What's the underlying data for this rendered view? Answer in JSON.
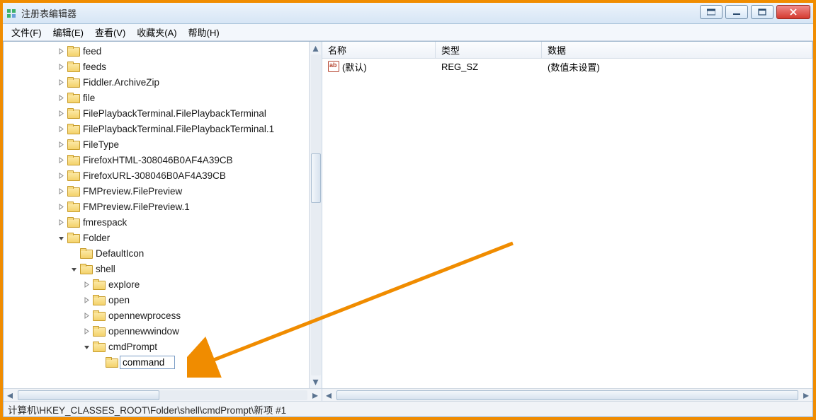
{
  "window": {
    "title": "注册表编辑器"
  },
  "menu": {
    "file": "文件(F)",
    "edit": "编辑(E)",
    "view": "查看(V)",
    "favorites": "收藏夹(A)",
    "help": "帮助(H)"
  },
  "tree": {
    "items": [
      {
        "label": "feed",
        "depth": 3,
        "expandable": true
      },
      {
        "label": "feeds",
        "depth": 3,
        "expandable": true
      },
      {
        "label": "Fiddler.ArchiveZip",
        "depth": 3,
        "expandable": true
      },
      {
        "label": "file",
        "depth": 3,
        "expandable": true
      },
      {
        "label": "FilePlaybackTerminal.FilePlaybackTerminal",
        "depth": 3,
        "expandable": true
      },
      {
        "label": "FilePlaybackTerminal.FilePlaybackTerminal.1",
        "depth": 3,
        "expandable": true
      },
      {
        "label": "FileType",
        "depth": 3,
        "expandable": true
      },
      {
        "label": "FirefoxHTML-308046B0AF4A39CB",
        "depth": 3,
        "expandable": true
      },
      {
        "label": "FirefoxURL-308046B0AF4A39CB",
        "depth": 3,
        "expandable": true
      },
      {
        "label": "FMPreview.FilePreview",
        "depth": 3,
        "expandable": true
      },
      {
        "label": "FMPreview.FilePreview.1",
        "depth": 3,
        "expandable": true
      },
      {
        "label": "fmrespack",
        "depth": 3,
        "expandable": true
      },
      {
        "label": "Folder",
        "depth": 3,
        "expandable": true,
        "expanded": true
      },
      {
        "label": "DefaultIcon",
        "depth": 4,
        "expandable": false
      },
      {
        "label": "shell",
        "depth": 4,
        "expandable": true,
        "expanded": true
      },
      {
        "label": "explore",
        "depth": 5,
        "expandable": true
      },
      {
        "label": "open",
        "depth": 5,
        "expandable": true
      },
      {
        "label": "opennewprocess",
        "depth": 5,
        "expandable": true
      },
      {
        "label": "opennewwindow",
        "depth": 5,
        "expandable": true
      },
      {
        "label": "cmdPrompt",
        "depth": 5,
        "expandable": true,
        "expanded": true
      },
      {
        "label": "command",
        "depth": 6,
        "expandable": false,
        "editing": true
      }
    ]
  },
  "list": {
    "header": {
      "name": "名称",
      "type": "类型",
      "data": "数据"
    },
    "rows": [
      {
        "name": "(默认)",
        "type": "REG_SZ",
        "data": "(数值未设置)"
      }
    ]
  },
  "status": {
    "path": "计算机\\HKEY_CLASSES_ROOT\\Folder\\shell\\cmdPrompt\\新项 #1"
  }
}
